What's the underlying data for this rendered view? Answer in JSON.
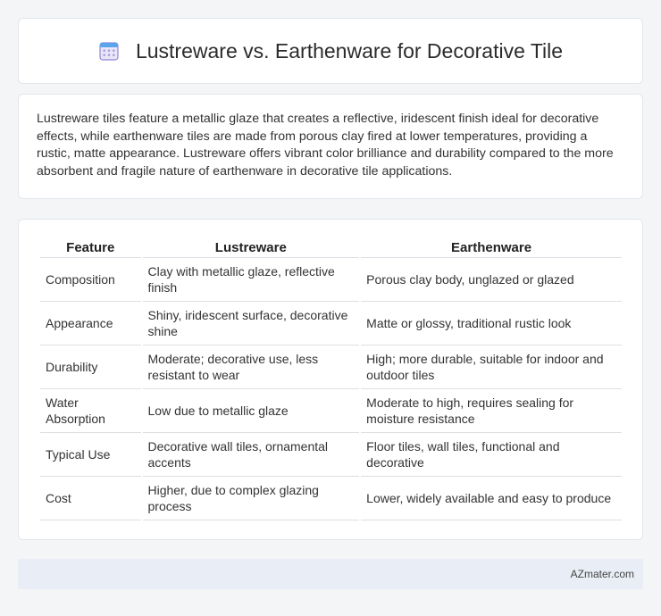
{
  "header": {
    "title": "Lustreware vs. Earthenware for Decorative Tile",
    "icon": "calendar-icon"
  },
  "intro": "Lustreware tiles feature a metallic glaze that creates a reflective, iridescent finish ideal for decorative effects, while earthenware tiles are made from porous clay fired at lower temperatures, providing a rustic, matte appearance. Lustreware offers vibrant color brilliance and durability compared to the more absorbent and fragile nature of earthenware in decorative tile applications.",
  "table": {
    "headers": [
      "Feature",
      "Lustreware",
      "Earthenware"
    ],
    "rows": [
      [
        "Composition",
        "Clay with metallic glaze, reflective finish",
        "Porous clay body, unglazed or glazed"
      ],
      [
        "Appearance",
        "Shiny, iridescent surface, decorative shine",
        "Matte or glossy, traditional rustic look"
      ],
      [
        "Durability",
        "Moderate; decorative use, less resistant to wear",
        "High; more durable, suitable for indoor and outdoor tiles"
      ],
      [
        "Water Absorption",
        "Low due to metallic glaze",
        "Moderate to high, requires sealing for moisture resistance"
      ],
      [
        "Typical Use",
        "Decorative wall tiles, ornamental accents",
        "Floor tiles, wall tiles, functional and decorative"
      ],
      [
        "Cost",
        "Higher, due to complex glazing process",
        "Lower, widely available and easy to produce"
      ]
    ]
  },
  "footer": {
    "brand": "AZmater.com"
  }
}
